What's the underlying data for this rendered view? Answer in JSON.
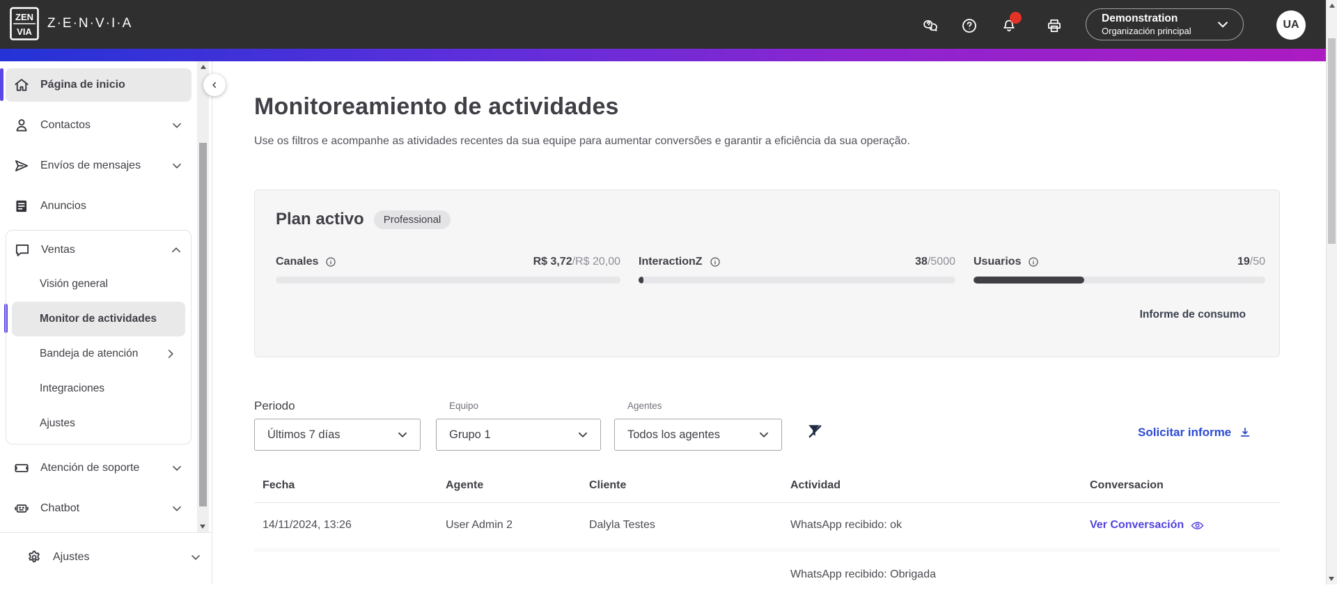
{
  "header": {
    "logo_text": "Z·E·N·V·I·A",
    "logo_mark_top": "ZEN",
    "logo_mark_bottom": "VIA",
    "org_name": "Demonstration",
    "org_subtitle": "Organización principal",
    "avatar_initials": "UA",
    "notification_badge_color": "#e23326"
  },
  "sidebar": {
    "accent_color": "#5a46e6",
    "items": [
      {
        "label": "Página de inicio"
      },
      {
        "label": "Contactos"
      },
      {
        "label": "Envíos de mensajes"
      },
      {
        "label": "Anuncios"
      },
      {
        "label": "Ventas"
      },
      {
        "label": "Atención de soporte"
      },
      {
        "label": "Chatbot"
      }
    ],
    "ventas_children": [
      {
        "label": "Visión general"
      },
      {
        "label": "Monitor de actividades"
      },
      {
        "label": "Bandeja de atención"
      },
      {
        "label": "Integraciones"
      },
      {
        "label": "Ajustes"
      }
    ],
    "selected_item": "Monitor de actividades",
    "bottom_item": {
      "label": "Ajustes"
    }
  },
  "main": {
    "title": "Monitoreamiento de actividades",
    "subtitle": "Use os filtros e acompanhe as atividades recentes da sua equipe para aumentar conversões e garantir a eficiência da sua operação.",
    "plan": {
      "title": "Plan activo",
      "badge": "Professional",
      "metrics": [
        {
          "label": "Canales",
          "value": "R$ 3,72",
          "limit": "/R$ 20,00",
          "fill_pct": 0
        },
        {
          "label": "InteractionZ",
          "value": "38",
          "limit": "/5000",
          "fill_pct": 1.5
        },
        {
          "label": "Usuarios",
          "value": "19",
          "limit": "/50",
          "fill_pct": 38
        }
      ],
      "consumption_link": "Informe de consumo"
    },
    "filters": {
      "periodo_label": "Periodo",
      "periodo_value": "Últimos 7 días",
      "equipo_label": "Equipo",
      "equipo_value": "Grupo 1",
      "agentes_label": "Agentes",
      "agentes_value": "Todos los agentes"
    },
    "request_report": "Solicitar informe",
    "table": {
      "headers": [
        "Fecha",
        "Agente",
        "Cliente",
        "Actividad",
        "Conversacion"
      ],
      "rows": [
        {
          "fecha": "14/11/2024, 13:26",
          "agente": "User Admin 2",
          "cliente": "Dalyla Testes",
          "actividad": "WhatsApp recibido: ok",
          "conversacion": "Ver Conversación"
        },
        {
          "fecha": "",
          "agente": "",
          "cliente": "",
          "actividad": "WhatsApp recibido: Obrigada",
          "conversacion": ""
        }
      ]
    }
  }
}
